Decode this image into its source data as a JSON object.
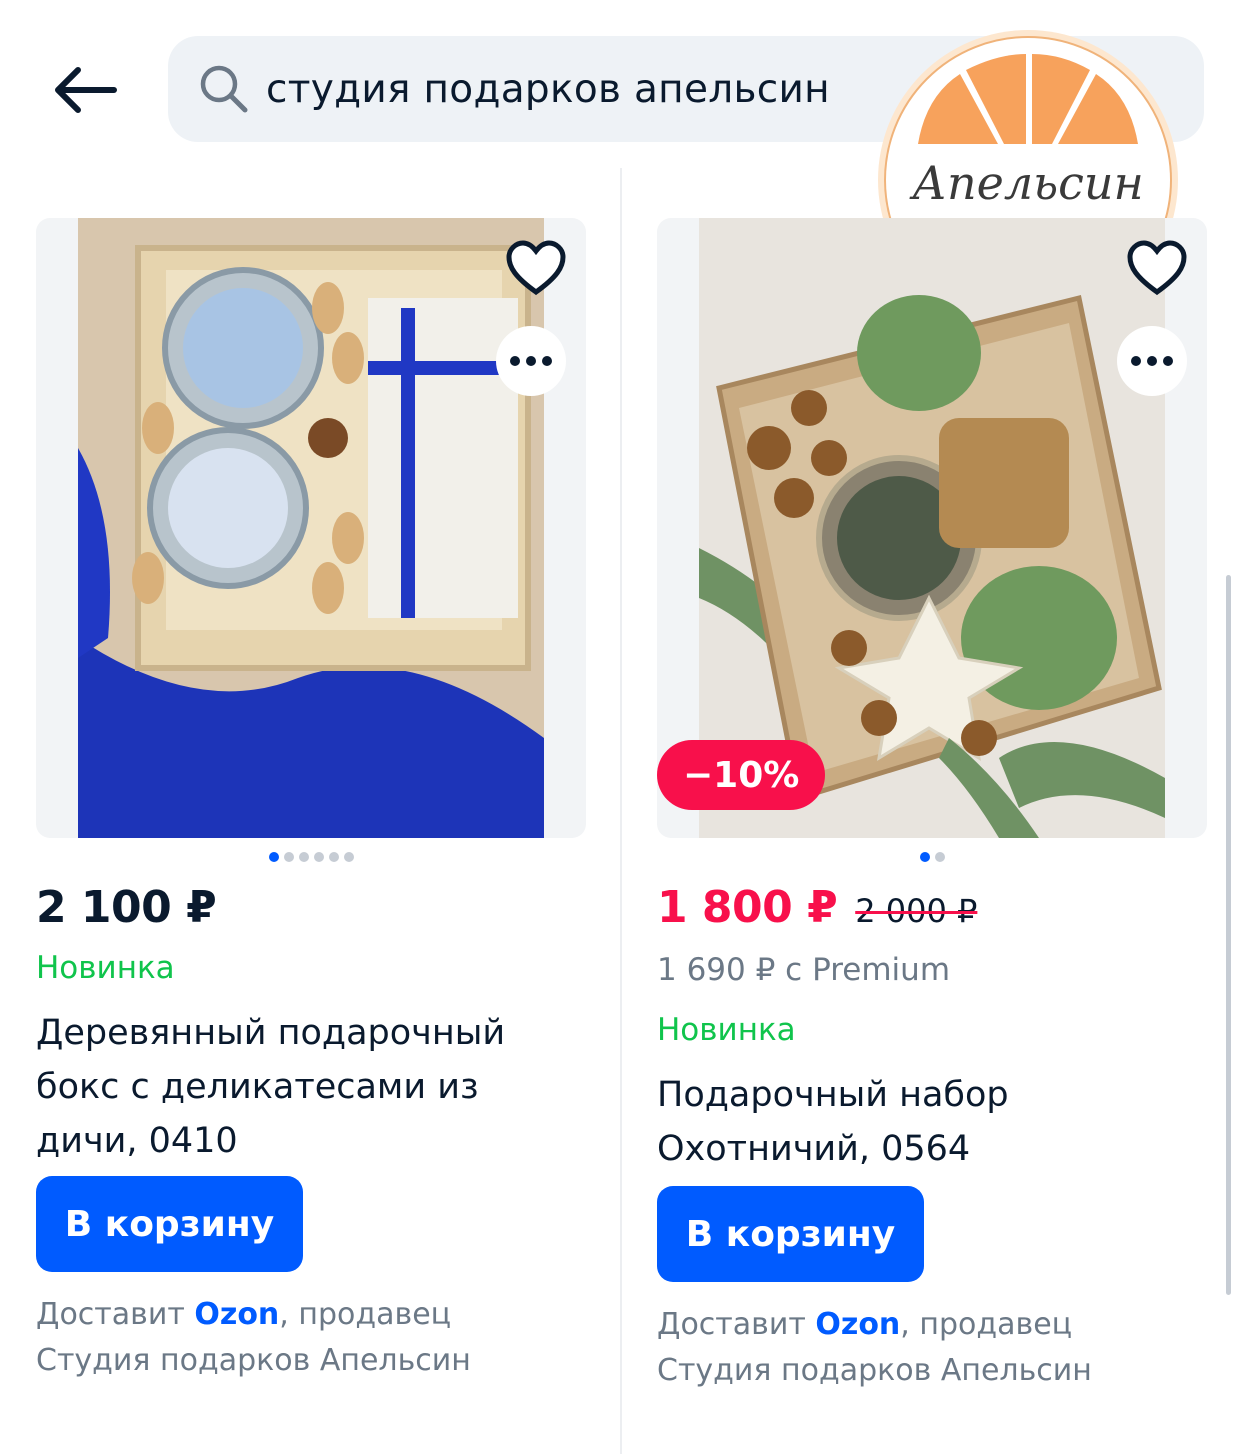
{
  "header": {
    "search_query": "студия подарков апельсин"
  },
  "logo": {
    "text": "Апельсин"
  },
  "products": [
    {
      "price": "2 100 ₽",
      "novelty": "Новинка",
      "title": "Деревянный подарочный бокс с деликатесами из дичи, 0410",
      "cart_label": "В корзину",
      "delivery_prefix": "Доставит",
      "delivery_brand": "Ozon",
      "delivery_suffix": ", продавец",
      "seller": "Студия подарков Апельсин",
      "image_dots": 6,
      "active_dot": 0
    },
    {
      "price": "1 800 ₽",
      "old_price": "2 000 ₽",
      "discount": "−10%",
      "premium_price": "1 690 ₽ с Premium",
      "novelty": "Новинка",
      "title": "Подарочный набор Охотничий, 0564",
      "cart_label": "В корзину",
      "delivery_prefix": "Доставит",
      "delivery_brand": "Ozon",
      "delivery_suffix": ", продавец",
      "seller": "Студия подарков Апельсин",
      "image_dots": 2,
      "active_dot": 0
    }
  ],
  "colors": {
    "accent": "#005bff",
    "sale": "#f8104b",
    "novelty": "#10c44c",
    "muted": "#6b7886"
  }
}
